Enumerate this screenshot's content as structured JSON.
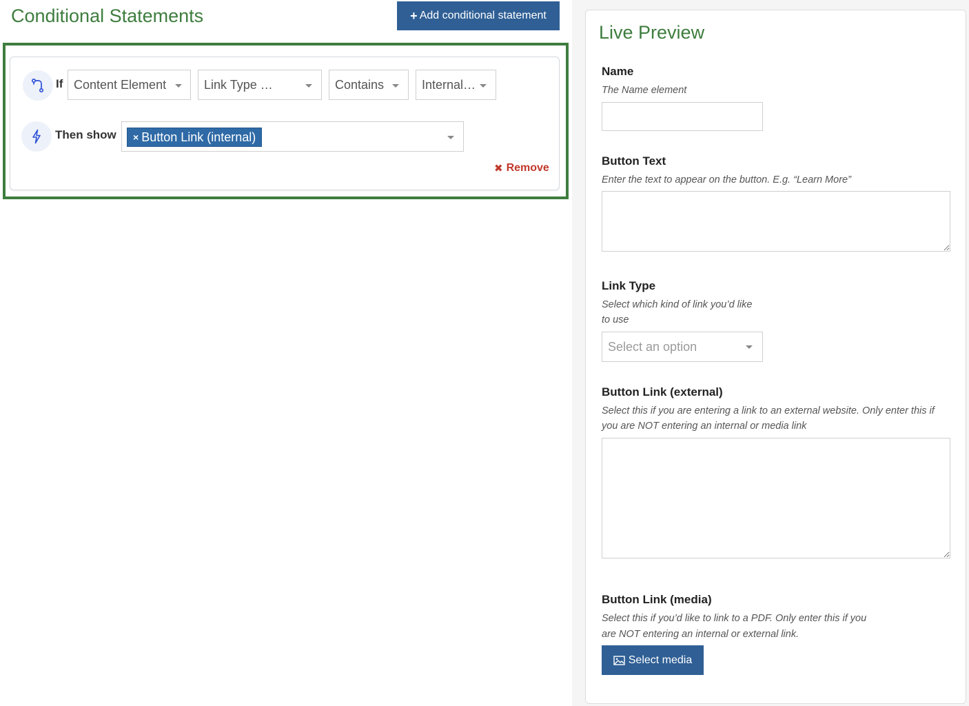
{
  "conditional": {
    "title": "Conditional Statements",
    "add_button": "Add conditional statement",
    "if_label": "If",
    "selects": [
      "Content Element",
      "Link Type …",
      "Contains",
      "Internal…"
    ],
    "then_label": "Then show",
    "tag_label": "Button Link (internal)",
    "tag_remove": "×",
    "remove_label": "Remove",
    "remove_icon": "✖"
  },
  "preview": {
    "title": "Live Preview",
    "fields": [
      {
        "label": "Name",
        "desc": "The Name element"
      },
      {
        "label": "Button Text",
        "desc": "Enter the text to appear on the button. E.g. “Learn More”"
      },
      {
        "label": "Link Type",
        "desc_line1": "Select which kind of link you’d like",
        "desc_line2": "to use",
        "placeholder": "Select an option"
      },
      {
        "label": "Button Link (external)",
        "desc_line1": "Select this if you are entering a link to an external website. Only enter this if",
        "desc_line2": "you are NOT entering an internal or media link"
      },
      {
        "label": "Button Link (media)",
        "desc_line1": "Select this if you’d like to link to a PDF. Only enter this if you",
        "desc_line2": "are NOT entering an internal or external link.",
        "button": "Select media"
      }
    ]
  },
  "icons": {
    "add": "plus-icon",
    "if": "git-branch-icon",
    "then": "lightning-icon",
    "remove": "cross-icon",
    "media": "image-icon"
  },
  "colors": {
    "accent_green": "#3e7d3e",
    "primary_blue": "#2f5f95",
    "tag_blue": "#2f6aa6",
    "danger": "#c0392b",
    "icon_blue": "#2b4fd8"
  }
}
